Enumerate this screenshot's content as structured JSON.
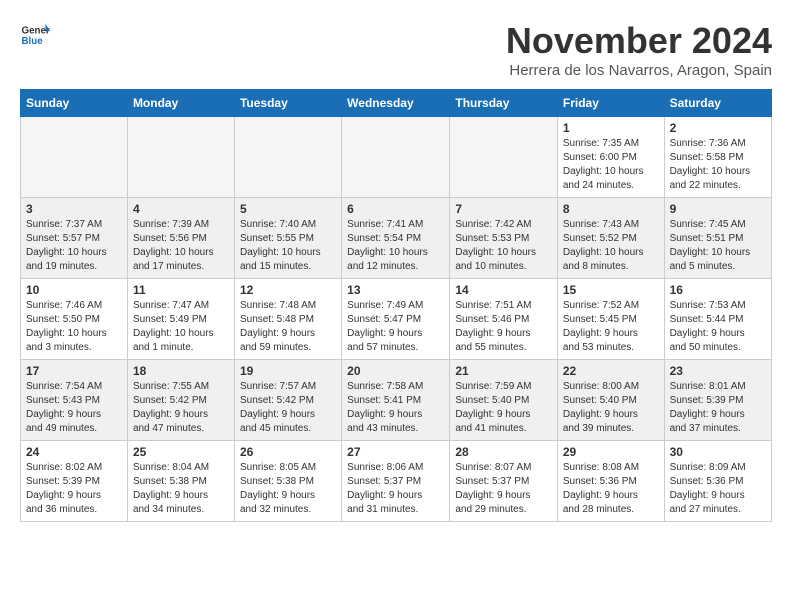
{
  "logo": {
    "line1": "General",
    "line2": "Blue"
  },
  "title": "November 2024",
  "subtitle": "Herrera de los Navarros, Aragon, Spain",
  "headers": [
    "Sunday",
    "Monday",
    "Tuesday",
    "Wednesday",
    "Thursday",
    "Friday",
    "Saturday"
  ],
  "weeks": [
    [
      {
        "day": "",
        "info": ""
      },
      {
        "day": "",
        "info": ""
      },
      {
        "day": "",
        "info": ""
      },
      {
        "day": "",
        "info": ""
      },
      {
        "day": "",
        "info": ""
      },
      {
        "day": "1",
        "info": "Sunrise: 7:35 AM\nSunset: 6:00 PM\nDaylight: 10 hours\nand 24 minutes."
      },
      {
        "day": "2",
        "info": "Sunrise: 7:36 AM\nSunset: 5:58 PM\nDaylight: 10 hours\nand 22 minutes."
      }
    ],
    [
      {
        "day": "3",
        "info": "Sunrise: 7:37 AM\nSunset: 5:57 PM\nDaylight: 10 hours\nand 19 minutes."
      },
      {
        "day": "4",
        "info": "Sunrise: 7:39 AM\nSunset: 5:56 PM\nDaylight: 10 hours\nand 17 minutes."
      },
      {
        "day": "5",
        "info": "Sunrise: 7:40 AM\nSunset: 5:55 PM\nDaylight: 10 hours\nand 15 minutes."
      },
      {
        "day": "6",
        "info": "Sunrise: 7:41 AM\nSunset: 5:54 PM\nDaylight: 10 hours\nand 12 minutes."
      },
      {
        "day": "7",
        "info": "Sunrise: 7:42 AM\nSunset: 5:53 PM\nDaylight: 10 hours\nand 10 minutes."
      },
      {
        "day": "8",
        "info": "Sunrise: 7:43 AM\nSunset: 5:52 PM\nDaylight: 10 hours\nand 8 minutes."
      },
      {
        "day": "9",
        "info": "Sunrise: 7:45 AM\nSunset: 5:51 PM\nDaylight: 10 hours\nand 5 minutes."
      }
    ],
    [
      {
        "day": "10",
        "info": "Sunrise: 7:46 AM\nSunset: 5:50 PM\nDaylight: 10 hours\nand 3 minutes."
      },
      {
        "day": "11",
        "info": "Sunrise: 7:47 AM\nSunset: 5:49 PM\nDaylight: 10 hours\nand 1 minute."
      },
      {
        "day": "12",
        "info": "Sunrise: 7:48 AM\nSunset: 5:48 PM\nDaylight: 9 hours\nand 59 minutes."
      },
      {
        "day": "13",
        "info": "Sunrise: 7:49 AM\nSunset: 5:47 PM\nDaylight: 9 hours\nand 57 minutes."
      },
      {
        "day": "14",
        "info": "Sunrise: 7:51 AM\nSunset: 5:46 PM\nDaylight: 9 hours\nand 55 minutes."
      },
      {
        "day": "15",
        "info": "Sunrise: 7:52 AM\nSunset: 5:45 PM\nDaylight: 9 hours\nand 53 minutes."
      },
      {
        "day": "16",
        "info": "Sunrise: 7:53 AM\nSunset: 5:44 PM\nDaylight: 9 hours\nand 50 minutes."
      }
    ],
    [
      {
        "day": "17",
        "info": "Sunrise: 7:54 AM\nSunset: 5:43 PM\nDaylight: 9 hours\nand 49 minutes."
      },
      {
        "day": "18",
        "info": "Sunrise: 7:55 AM\nSunset: 5:42 PM\nDaylight: 9 hours\nand 47 minutes."
      },
      {
        "day": "19",
        "info": "Sunrise: 7:57 AM\nSunset: 5:42 PM\nDaylight: 9 hours\nand 45 minutes."
      },
      {
        "day": "20",
        "info": "Sunrise: 7:58 AM\nSunset: 5:41 PM\nDaylight: 9 hours\nand 43 minutes."
      },
      {
        "day": "21",
        "info": "Sunrise: 7:59 AM\nSunset: 5:40 PM\nDaylight: 9 hours\nand 41 minutes."
      },
      {
        "day": "22",
        "info": "Sunrise: 8:00 AM\nSunset: 5:40 PM\nDaylight: 9 hours\nand 39 minutes."
      },
      {
        "day": "23",
        "info": "Sunrise: 8:01 AM\nSunset: 5:39 PM\nDaylight: 9 hours\nand 37 minutes."
      }
    ],
    [
      {
        "day": "24",
        "info": "Sunrise: 8:02 AM\nSunset: 5:39 PM\nDaylight: 9 hours\nand 36 minutes."
      },
      {
        "day": "25",
        "info": "Sunrise: 8:04 AM\nSunset: 5:38 PM\nDaylight: 9 hours\nand 34 minutes."
      },
      {
        "day": "26",
        "info": "Sunrise: 8:05 AM\nSunset: 5:38 PM\nDaylight: 9 hours\nand 32 minutes."
      },
      {
        "day": "27",
        "info": "Sunrise: 8:06 AM\nSunset: 5:37 PM\nDaylight: 9 hours\nand 31 minutes."
      },
      {
        "day": "28",
        "info": "Sunrise: 8:07 AM\nSunset: 5:37 PM\nDaylight: 9 hours\nand 29 minutes."
      },
      {
        "day": "29",
        "info": "Sunrise: 8:08 AM\nSunset: 5:36 PM\nDaylight: 9 hours\nand 28 minutes."
      },
      {
        "day": "30",
        "info": "Sunrise: 8:09 AM\nSunset: 5:36 PM\nDaylight: 9 hours\nand 27 minutes."
      }
    ]
  ]
}
